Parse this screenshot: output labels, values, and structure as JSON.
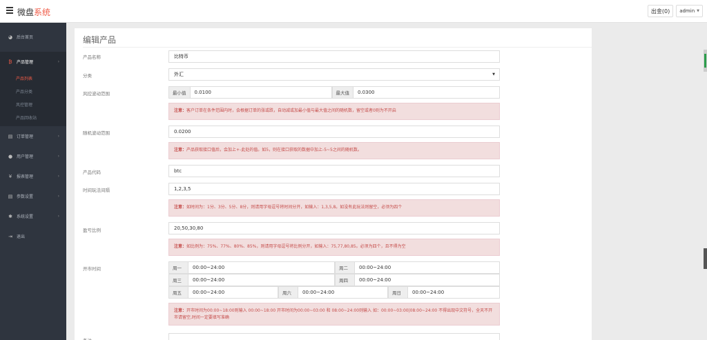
{
  "header": {
    "brand_part1": "微盘",
    "brand_part2": "系统",
    "withdraw_label": "出金(0)",
    "user_label": "admin"
  },
  "sidebar": {
    "items": [
      {
        "label": "后台首页",
        "icon": "dashboard-icon"
      },
      {
        "label": "产品管理",
        "icon": "bitcoin-icon"
      },
      {
        "label": "订单管理",
        "icon": "copy-icon"
      },
      {
        "label": "用户管理",
        "icon": "user-icon"
      },
      {
        "label": "报表管理",
        "icon": "yen-icon"
      },
      {
        "label": "参数设置",
        "icon": "copy-icon"
      },
      {
        "label": "系统设置",
        "icon": "gears-icon"
      },
      {
        "label": "退出",
        "icon": "sign-out-icon"
      }
    ],
    "sub_items": [
      "产品列表",
      "产品分类",
      "风控管理",
      "产品回收站"
    ]
  },
  "page": {
    "title": "编辑产品",
    "fields": {
      "name_label": "产品名称",
      "name_value": "比特币",
      "category_label": "分类",
      "category_value": "外汇",
      "risk_label": "风控波动范围",
      "min_label": "最小值",
      "min_value": "0.0100",
      "max_label": "最大值",
      "max_value": "0.0300",
      "risk_note_title": "注意：",
      "risk_note": "客户订单在条件范围内时，会根据订单的涨或跌，自动减或加最小值与最大值之间的随机数，留空或者0则为不开启",
      "random_label": "随机波动范围",
      "random_value": "0.0200",
      "random_note_title": "注意：",
      "random_note": "产品获取接口值后，会加上+-此处的值。如5，则在接口获取的数据中加上-5~5之间的随机数。",
      "code_label": "产品代码",
      "code_value": "btc",
      "interval_label": "时间玩法间隔",
      "interval_value": "1,2,3,5",
      "interval_note_title": "注意：",
      "interval_note": "如时间为：1分、3分、5分、8分，则请用字母逗号将时间分开，如输入：1,3,5,8。如没有此玩法则留空，必须为四个",
      "ratio_label": "盈亏比例",
      "ratio_value": "20,50,30,80",
      "ratio_note_title": "注意：",
      "ratio_note": "如比例为：75%、77%、80%、85%，则请用字母逗号将比例分开，如输入：75,77,80,85。必须为四个，且不得为空",
      "open_label": "开市时间",
      "days": [
        {
          "day": "周一",
          "time": "00:00~24:00"
        },
        {
          "day": "周二",
          "time": "00:00~24:00"
        },
        {
          "day": "周三",
          "time": "00:00~24:00"
        },
        {
          "day": "周四",
          "time": "00:00~24:00"
        },
        {
          "day": "周五",
          "time": "00:00~24:00"
        },
        {
          "day": "周六",
          "time": "00:00~24:00"
        },
        {
          "day": "周日",
          "time": "00:00~24:00"
        }
      ],
      "open_note_title": "注意：",
      "open_note": "开市时间为00:00~18:00则输入 00:00~18:00 开市时间为00:00~03:00 和 08:00~24:00则输入 如：00:00~03:00|08:00~24:00 不得出现中文符号，全天不开市请留空,时间一定要填写准确",
      "remark_label": "备注"
    }
  },
  "colors": {
    "brand_accent": "#ef5a46",
    "sidebar_bg": "#2f353f",
    "alert_bg": "#f2dede",
    "alert_text": "#c54c4a"
  }
}
